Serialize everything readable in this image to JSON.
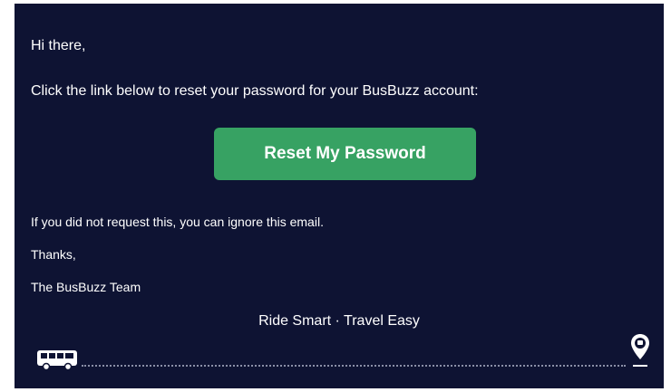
{
  "email": {
    "greeting": "Hi there,",
    "instruction": "Click the link below to reset your password for your BusBuzz account:",
    "reset_button_label": "Reset My Password",
    "ignore_note": "If you did not request this, you can ignore this email.",
    "signoff": "Thanks,",
    "signature": "The BusBuzz Team",
    "tagline": "Ride Smart · Travel Easy"
  },
  "icons": {
    "bus": "bus-icon",
    "pin": "location-pin-icon"
  },
  "colors": {
    "background": "#0e1333",
    "button": "#37a263",
    "text": "#ffffff"
  }
}
